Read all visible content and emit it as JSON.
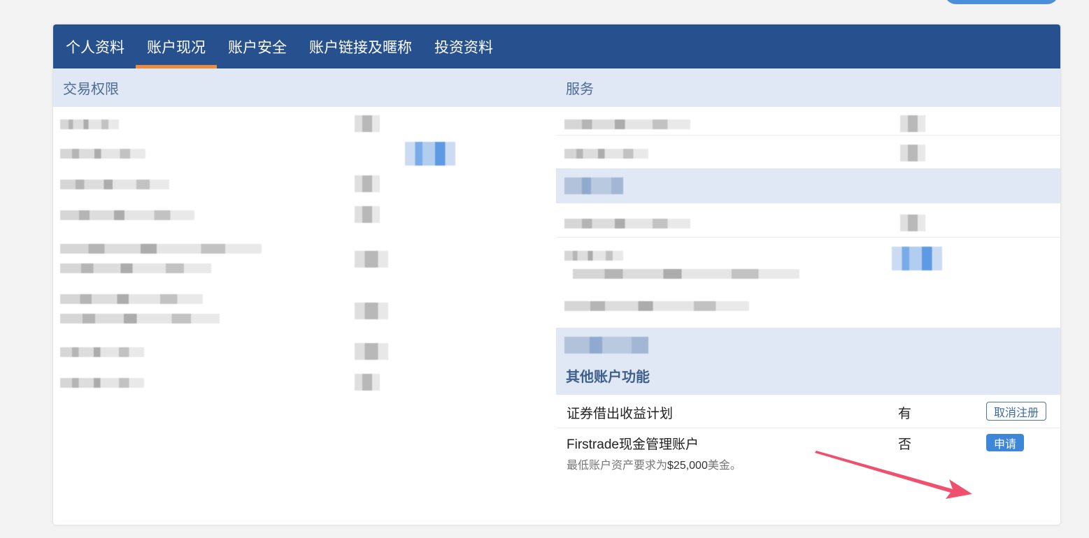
{
  "tabs": [
    {
      "label": "个人资料",
      "active": false
    },
    {
      "label": "账户现况",
      "active": true
    },
    {
      "label": "账户安全",
      "active": false
    },
    {
      "label": "账户链接及暱称",
      "active": false
    },
    {
      "label": "投资资料",
      "active": false
    }
  ],
  "left_section": {
    "header": "交易权限"
  },
  "right_section": {
    "header": "服务"
  },
  "other_features": {
    "header": "其他账户功能",
    "items": [
      {
        "name": "证券借出收益计划",
        "value": "有",
        "button": "取消注册"
      },
      {
        "name": "Firstrade现金管理账户",
        "value": "否",
        "button": "申请",
        "note_prefix": "最低账户资产要求为",
        "note_amount": "$25,000",
        "note_suffix": "美金。"
      }
    ]
  },
  "colors": {
    "nav_bg": "#27508f",
    "tab_active_underline": "#f08a3c",
    "section_header_bg": "#dfe8f4",
    "accent_blue": "#3d86d8",
    "arrow": "#f0506e"
  }
}
